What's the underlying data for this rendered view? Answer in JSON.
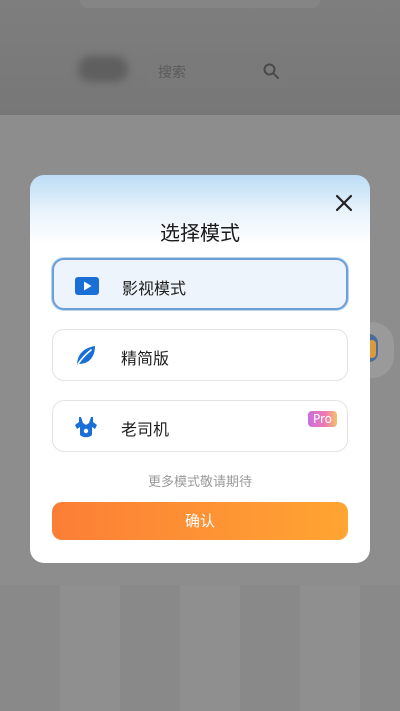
{
  "background": {
    "search_placeholder": "搜索",
    "search_icon": "search-icon"
  },
  "dialog": {
    "title": "选择模式",
    "close_icon": "close-icon",
    "options": [
      {
        "label": "影视模式",
        "icon": "play-icon",
        "selected": true
      },
      {
        "label": "精简版",
        "icon": "leaf-icon",
        "selected": false
      },
      {
        "label": "老司机",
        "icon": "bodysuit-icon",
        "selected": false,
        "badge": "Pro"
      }
    ],
    "hint": "更多模式敬请期待",
    "confirm_label": "确认"
  },
  "colors": {
    "accent_blue": "#1a6fd6",
    "confirm_start": "#fc7e36",
    "confirm_end": "#ffa532",
    "selected_border": "#6a9fd8"
  }
}
